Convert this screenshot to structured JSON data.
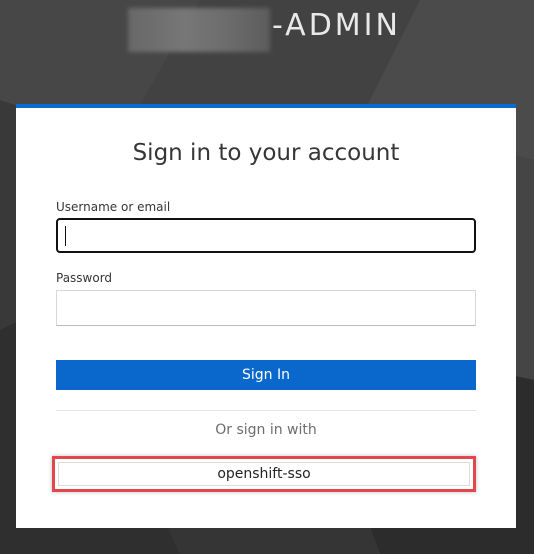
{
  "header": {
    "realm_suffix": "-ADMIN"
  },
  "login": {
    "title": "Sign in to your account",
    "username_label": "Username or email",
    "username_value": "",
    "password_label": "Password",
    "password_value": "",
    "signin_label": "Sign In",
    "or_text": "Or sign in with",
    "providers": [
      {
        "label": "openshift-sso"
      }
    ]
  },
  "colors": {
    "accent": "#0a68cc",
    "card_top_border": "#0a6ad0",
    "highlight": "#e0484e",
    "background": "#3f3f3f"
  }
}
